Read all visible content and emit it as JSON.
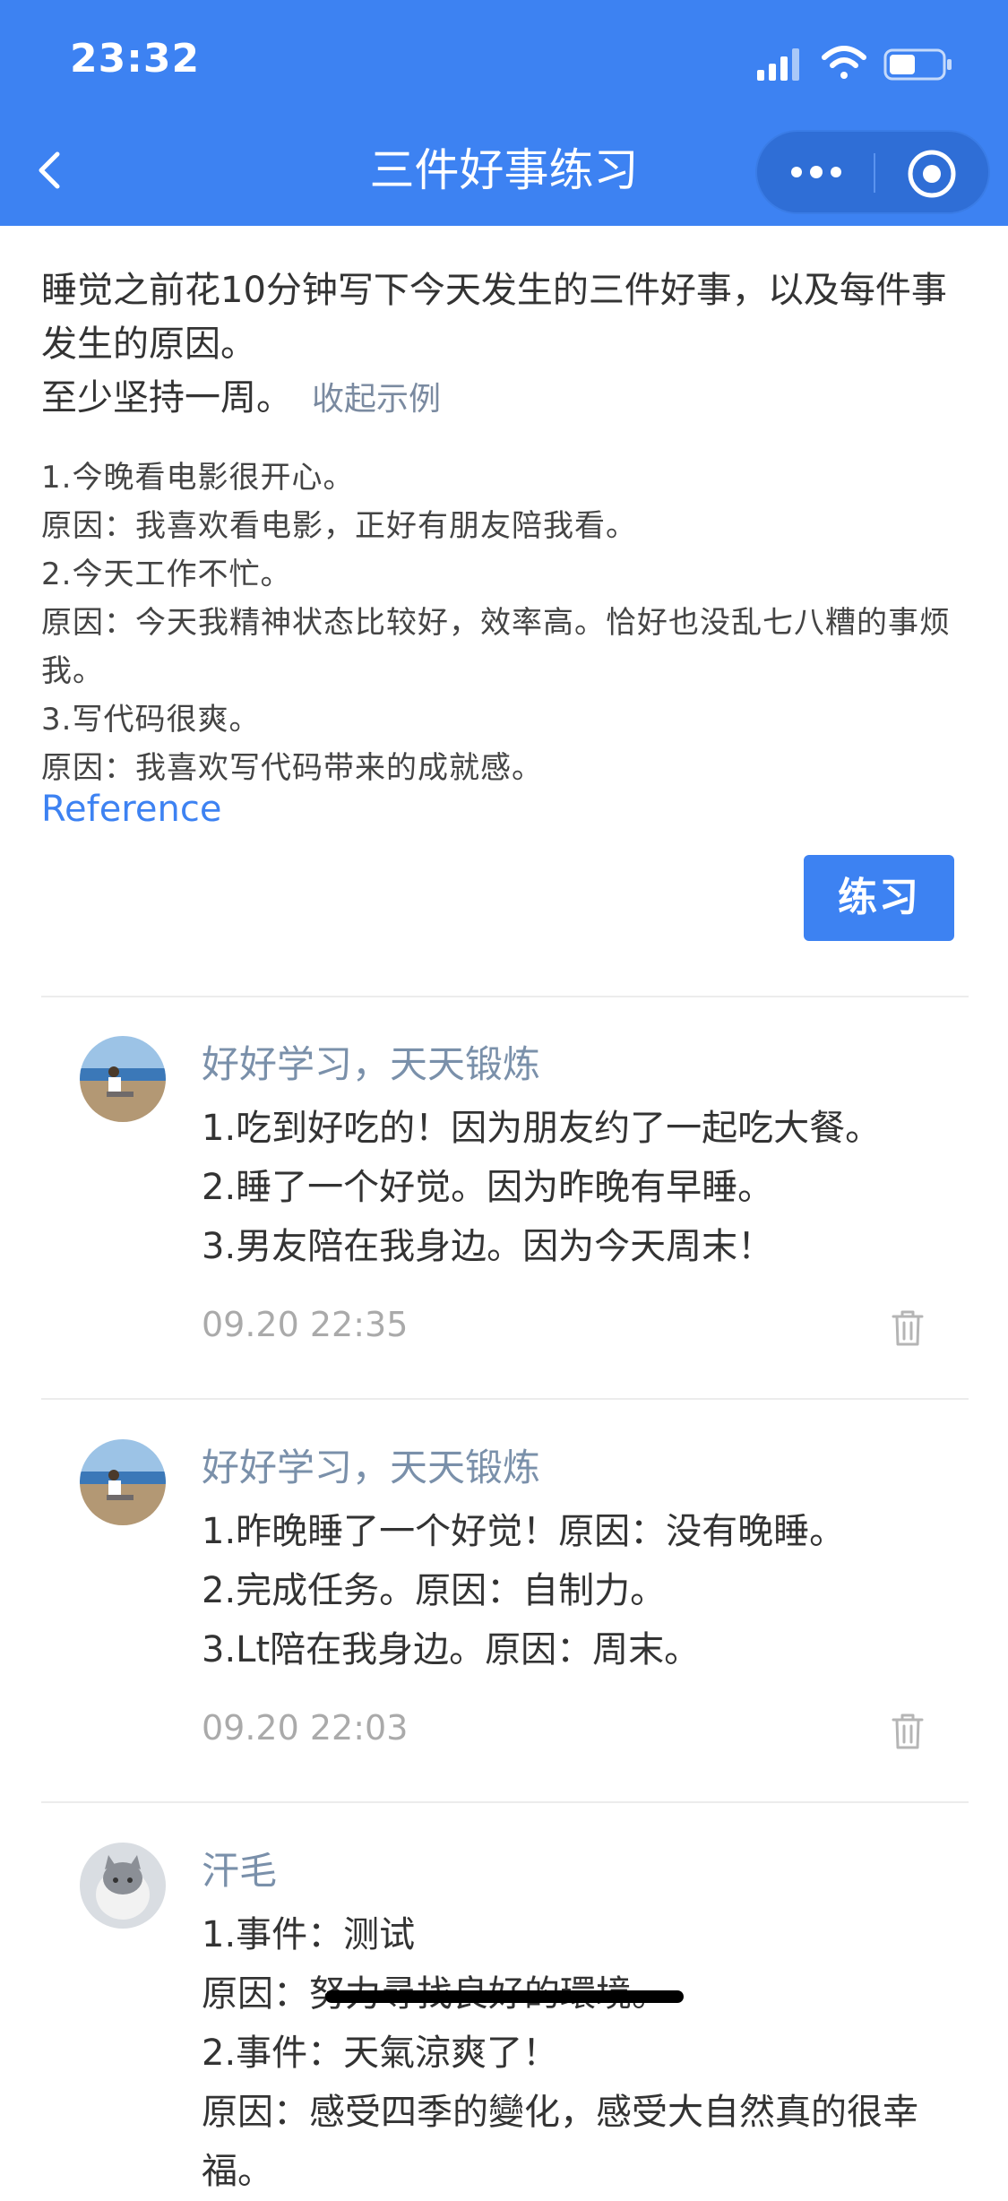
{
  "status_bar": {
    "time": "23:32"
  },
  "nav": {
    "title": "三件好事练习",
    "back_icon": "chevron-left-icon",
    "more_icon": "more-dots-icon",
    "close_icon": "target-circle-icon"
  },
  "intro": {
    "line1": "睡觉之前花10分钟写下今天发生的三件好事，以及每件事发生的原因。",
    "line2": "至少坚持一周。",
    "collapse_label": "收起示例"
  },
  "examples": [
    "1.今晚看电影很开心。",
    "原因：我喜欢看电影，正好有朋友陪我看。",
    "2.今天工作不忙。",
    "原因：今天我精神状态比较好，效率高。恰好也没乱七八糟的事烦我。",
    "3.写代码很爽。",
    "原因：我喜欢写代码带来的成就感。"
  ],
  "reference_label": "Reference",
  "practice_button": "练习",
  "posts": [
    {
      "author": "好好学习，天天锻炼",
      "lines": [
        "1.吃到好吃的！因为朋友约了一起吃大餐。",
        "2.睡了一个好觉。因为昨晚有早睡。",
        "3.男友陪在我身边。因为今天周末！"
      ],
      "time": "09.20 22:35"
    },
    {
      "author": "好好学习，天天锻炼",
      "lines": [
        "1.昨晚睡了一个好觉！原因：没有晚睡。",
        "2.完成任务。原因：自制力。",
        "3.Lt陪在我身边。原因：周末。"
      ],
      "time": "09.20 22:03"
    },
    {
      "author": "汗毛",
      "lines": [
        "1.事件：测试",
        "原因：努力尋找良好的環境。",
        "2.事件：天氣涼爽了！",
        "原因：感受四季的變化，感受大自然真的很幸福。"
      ]
    }
  ],
  "colors": {
    "accent": "#3d82f2",
    "author": "#7a90aa",
    "meta": "#aaaaaa"
  }
}
